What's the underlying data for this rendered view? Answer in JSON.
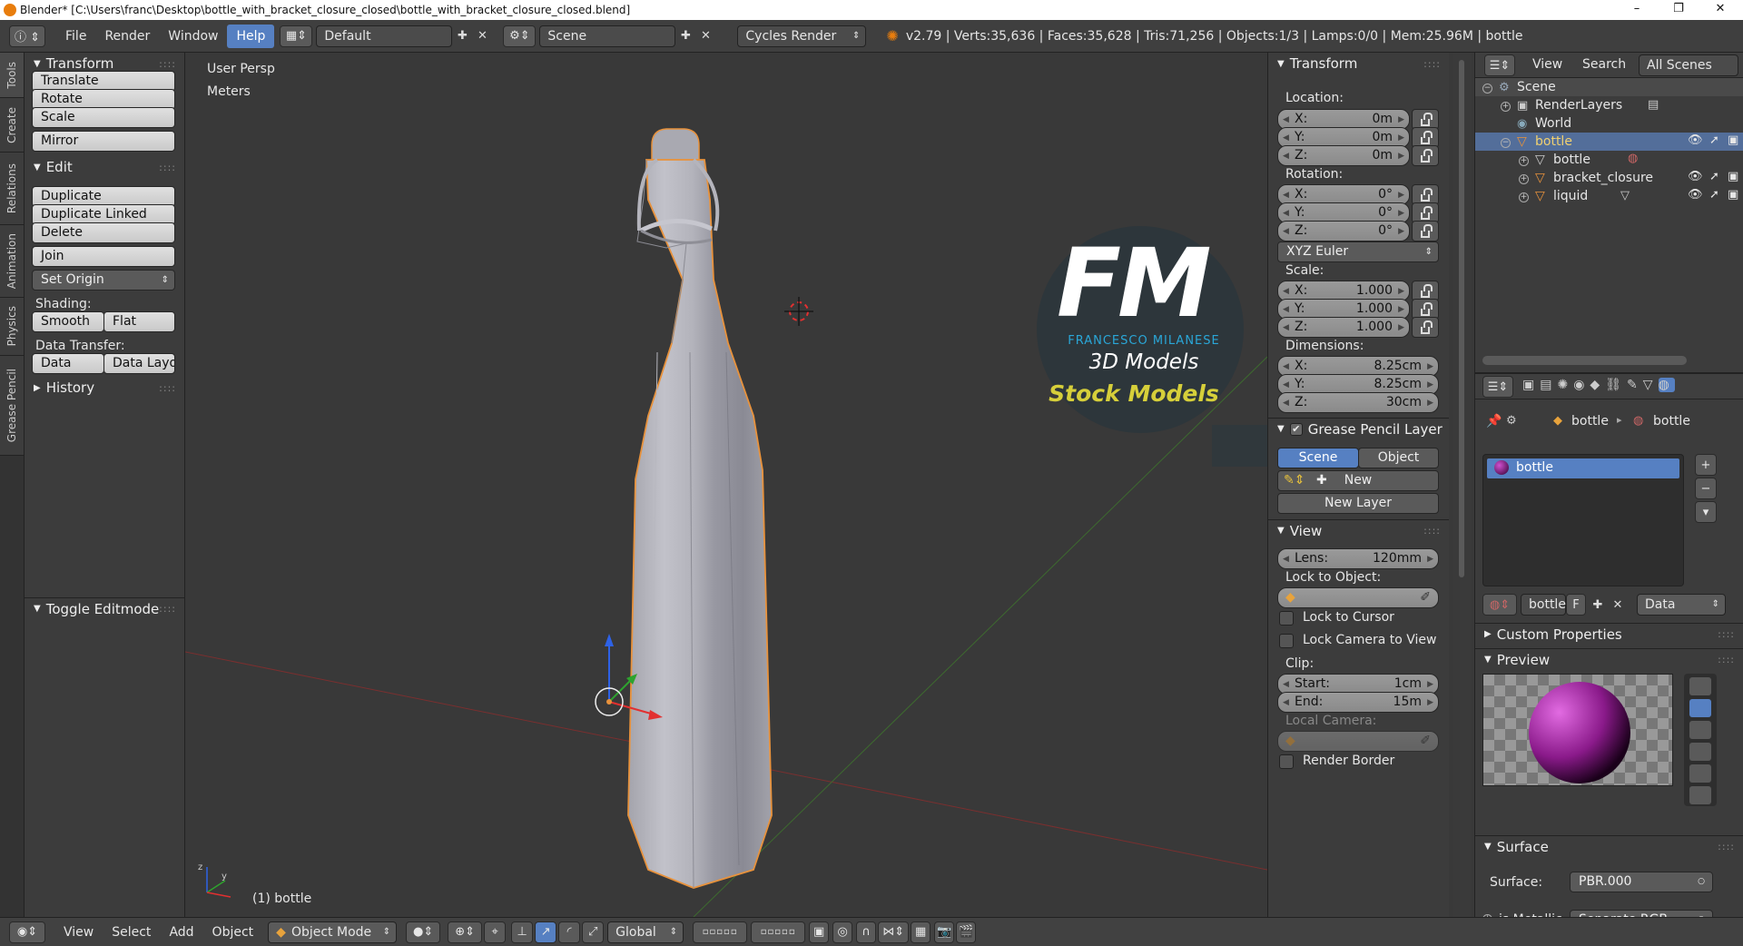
{
  "titlebar": {
    "title": "Blender* [C:\\Users\\franc\\Desktop\\bottle_with_bracket_closure_closed\\bottle_with_bracket_closure_closed.blend]",
    "minimize": "–",
    "maximize": "❐",
    "close": "✕"
  },
  "infobar": {
    "menus": [
      "File",
      "Render",
      "Window",
      "Help"
    ],
    "layout": "Default",
    "scene": "Scene",
    "engine": "Cycles Render",
    "stats": "v2.79 | Verts:35,636 | Faces:35,628 | Tris:71,256 | Objects:1/3 | Lamps:0/0 | Mem:25.96M | bottle"
  },
  "tabs": [
    "Tools",
    "Create",
    "Relations",
    "Animation",
    "Physics",
    "Grease Pencil"
  ],
  "tools": {
    "transform_header": "Transform",
    "translate": "Translate",
    "rotate": "Rotate",
    "scale": "Scale",
    "mirror": "Mirror",
    "edit_header": "Edit",
    "duplicate": "Duplicate",
    "duplicate_linked": "Duplicate Linked",
    "delete": "Delete",
    "join": "Join",
    "set_origin": "Set Origin",
    "shading_label": "Shading:",
    "smooth": "Smooth",
    "flat": "Flat",
    "data_transfer_label": "Data Transfer:",
    "data": "Data",
    "data_layout": "Data Layo",
    "history_header": "History",
    "toggle_editmode": "Toggle Editmode"
  },
  "viewport": {
    "view_name": "User Persp",
    "units": "Meters",
    "object_label": "(1) bottle",
    "logo_letters": "FM",
    "logo_name": "FRANCESCO MILANESE",
    "logo_sub": "3D Models",
    "stock": "Stock Models",
    "axis_y": "y",
    "axis_z": "z"
  },
  "npanel": {
    "transform_header": "Transform",
    "location_label": "Location:",
    "location": [
      {
        "axis": "X:",
        "value": "0m"
      },
      {
        "axis": "Y:",
        "value": "0m"
      },
      {
        "axis": "Z:",
        "value": "0m"
      }
    ],
    "rotation_label": "Rotation:",
    "rotation": [
      {
        "axis": "X:",
        "value": "0°"
      },
      {
        "axis": "Y:",
        "value": "0°"
      },
      {
        "axis": "Z:",
        "value": "0°"
      }
    ],
    "rotation_mode": "XYZ Euler",
    "scale_label": "Scale:",
    "scale": [
      {
        "axis": "X:",
        "value": "1.000"
      },
      {
        "axis": "Y:",
        "value": "1.000"
      },
      {
        "axis": "Z:",
        "value": "1.000"
      }
    ],
    "dimensions_label": "Dimensions:",
    "dimensions": [
      {
        "axis": "X:",
        "value": "8.25cm"
      },
      {
        "axis": "Y:",
        "value": "8.25cm"
      },
      {
        "axis": "Z:",
        "value": "30cm"
      }
    ],
    "gp_header": "Grease Pencil Layer",
    "gp_scene": "Scene",
    "gp_object": "Object",
    "gp_new": "New",
    "gp_new_layer": "New Layer",
    "view_header": "View",
    "lens_label": "Lens:",
    "lens_value": "120mm",
    "lock_to_object": "Lock to Object:",
    "lock_to_cursor": "Lock to Cursor",
    "lock_camera": "Lock Camera to View",
    "clip_label": "Clip:",
    "clip_start_label": "Start:",
    "clip_start": "1cm",
    "clip_end_label": "End:",
    "clip_end": "15m",
    "local_camera": "Local Camera:",
    "render_border": "Render Border"
  },
  "outliner": {
    "view": "View",
    "search": "Search",
    "all_scenes": "All Scenes",
    "items": [
      "Scene",
      "RenderLayers",
      "World",
      "bottle",
      "bottle",
      "bracket_closure",
      "liquid"
    ]
  },
  "properties": {
    "crumb_object": "bottle",
    "crumb_material": "bottle",
    "slot_name": "bottle",
    "material_name": "bottle",
    "fake_user": "F",
    "link": "Data",
    "custom_props": "Custom Properties",
    "preview": "Preview",
    "surface_header": "Surface",
    "surface_label": "Surface:",
    "surface_value": "PBR.000",
    "metallic_label": "is Metallic",
    "metallic_value": "Separate RGB"
  },
  "bottombar": {
    "view": "View",
    "select": "Select",
    "add": "Add",
    "object": "Object",
    "mode": "Object Mode",
    "orientation": "Global"
  },
  "colors": {
    "selected_blue": "#5680c2",
    "object_outline": "#e8923c",
    "logo_cyan": "#2aa7d8",
    "stock_yellow": "#d6cf3a"
  }
}
